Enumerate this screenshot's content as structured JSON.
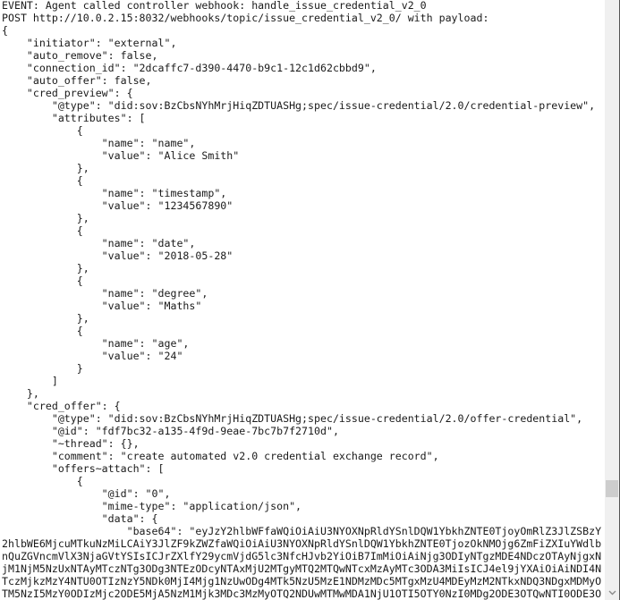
{
  "console": {
    "lines": [
      "EVENT: Agent called controller webhook: handle_issue_credential_v2_0",
      "POST http://10.0.2.15:8032/webhooks/topic/issue_credential_v2_0/ with payload:",
      "{",
      "    \"initiator\": \"external\",",
      "    \"auto_remove\": false,",
      "    \"connection_id\": \"2dcaffc7-d390-4470-b9c1-12c1d62cbbd9\",",
      "    \"auto_offer\": false,",
      "    \"cred_preview\": {",
      "        \"@type\": \"did:sov:BzCbsNYhMrjHiqZDTUASHg;spec/issue-credential/2.0/credential-preview\",",
      "        \"attributes\": [",
      "            {",
      "                \"name\": \"name\",",
      "                \"value\": \"Alice Smith\"",
      "            },",
      "            {",
      "                \"name\": \"timestamp\",",
      "                \"value\": \"1234567890\"",
      "            },",
      "            {",
      "                \"name\": \"date\",",
      "                \"value\": \"2018-05-28\"",
      "            },",
      "            {",
      "                \"name\": \"degree\",",
      "                \"value\": \"Maths\"",
      "            },",
      "            {",
      "                \"name\": \"age\",",
      "                \"value\": \"24\"",
      "            }",
      "        ]",
      "    },",
      "    \"cred_offer\": {",
      "        \"@type\": \"did:sov:BzCbsNYhMrjHiqZDTUASHg;spec/issue-credential/2.0/offer-credential\",",
      "        \"@id\": \"fdf7bc32-a135-4f9d-9eae-7bc7b7f2710d\",",
      "        \"~thread\": {},",
      "        \"comment\": \"create automated v2.0 credential exchange record\",",
      "        \"offers~attach\": [",
      "            {",
      "                \"@id\": \"0\",",
      "                \"mime-type\": \"application/json\",",
      "                \"data\": {",
      "                    \"base64\": \"eyJzY2hlbWFfaWQiOiAiU3NYOXNpRldYSnlDQW1YbkhZNTE0TjoyOmRlZ3JlZSBzY",
      "2hlbWE6MjcuMTkuNzMiLCAiY3JlZF9kZWZfaWQiOiAiU3NYOXNpRldYSnlDQW1YbkhZNTE0TjozOkNMOjg6ZmFiZXIuYWdlb",
      "nQuZGVncmVlX3NjaGVtYSIsICJrZXlfY29ycmVjdG5lc3NfcHJvb2YiOiB7ImMiOiAiNjg3ODIyNTgzMDE4NDczOTAyNjgxN",
      "jM1NjM5NzUxNTAyMTczNTg3ODg3NTEzODcyNTAxMjU2MTgyMTQ2MTQwNTcxMzAyMTc3ODA3MiIsICJ4el9jYXAiOiAiNDI4N",
      "TczMjkzMzY4NTU0OTIzNzY5NDk0MjI4Mjg1NzUwODg4MTk5NzU5MzE1NDMzMDc5MTgxMzU4MDEyMzM2NTkxNDQ3NDgxMDMyO",
      "TM5NzI5MzY0ODIzMjc2ODE5MjA5NzM1Mjk3MDc3MzMyOTQ2NDUwMTMwMDA1NjU1OTI5OTY0NzI0MDg2ODE3OTQwNTI0ODE3O"
    ]
  },
  "scrollbar": {
    "down_arrow_icon": "chevron-down-icon",
    "position": 0.82
  }
}
